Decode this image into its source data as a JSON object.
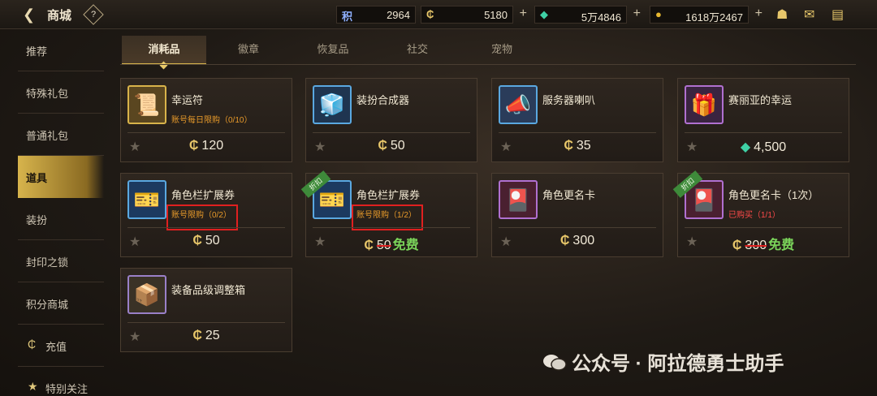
{
  "header": {
    "title": "商城",
    "help_label": "?",
    "currencies": [
      {
        "icon": "积",
        "value": "2964"
      },
      {
        "icon": "₵",
        "value": "5180"
      },
      {
        "icon": "◆",
        "value": "5万4846"
      },
      {
        "icon": "●",
        "value": "1618万2467"
      }
    ],
    "plus_label": "+"
  },
  "sidebar": {
    "items": [
      {
        "label": "推荐"
      },
      {
        "label": "特殊礼包"
      },
      {
        "label": "普通礼包"
      },
      {
        "label": "道具"
      },
      {
        "label": "装扮"
      },
      {
        "label": "封印之锁"
      },
      {
        "label": "积分商城"
      },
      {
        "label": "充值",
        "icon": "₵"
      },
      {
        "label": "特别关注",
        "icon": "★"
      }
    ],
    "active_index": 3
  },
  "tabs": [
    {
      "label": "消耗品"
    },
    {
      "label": "徽章"
    },
    {
      "label": "恢复品"
    },
    {
      "label": "社交"
    },
    {
      "label": "宠物"
    }
  ],
  "items": [
    {
      "name": "幸运符",
      "limit": "账号每日限购（0/10）",
      "price": "120",
      "currency": "₵",
      "icon": "scroll-icon",
      "glyph": "📜"
    },
    {
      "name": "装扮合成器",
      "limit": "",
      "price": "50",
      "currency": "₵",
      "icon": "cube-icon",
      "glyph": "🧊"
    },
    {
      "name": "服务器喇叭",
      "limit": "",
      "price": "35",
      "currency": "₵",
      "icon": "megaphone-icon",
      "glyph": "📣"
    },
    {
      "name": "赛丽亚的幸运",
      "limit": "",
      "price": "4,500",
      "currency": "◆",
      "icon": "gift-icon",
      "glyph": "🎁"
    },
    {
      "name": "角色栏扩展券",
      "limit": "账号限购（0/2）",
      "price": "50",
      "currency": "₵",
      "icon": "ticket-icon",
      "glyph": "🎫"
    },
    {
      "name": "角色栏扩展券",
      "limit": "账号限购（1/2）",
      "old_price": "50",
      "free": "免费",
      "currency": "₵",
      "icon": "ticket-icon",
      "glyph": "🎫",
      "ribbon": "折扣"
    },
    {
      "name": "角色更名卡",
      "limit": "",
      "price": "300",
      "currency": "₵",
      "icon": "card-icon",
      "glyph": "🎴"
    },
    {
      "name": "角色更名卡（1次）",
      "limit": "已购买（1/1）",
      "old_price": "300",
      "free": "免费",
      "currency": "₵",
      "icon": "card-icon",
      "glyph": "🎴",
      "ribbon": "折扣"
    },
    {
      "name": "装备品级调整箱",
      "limit": "",
      "price": "25",
      "currency": "₵",
      "icon": "box-icon",
      "glyph": "📦"
    }
  ],
  "star_glyph": "★",
  "watermark": "公众号 · 阿拉德勇士助手",
  "colors": {
    "accent": "#d7b44c",
    "limit": "#e89a2a",
    "highlight_box": "#e02020",
    "free": "#7ad45a"
  }
}
